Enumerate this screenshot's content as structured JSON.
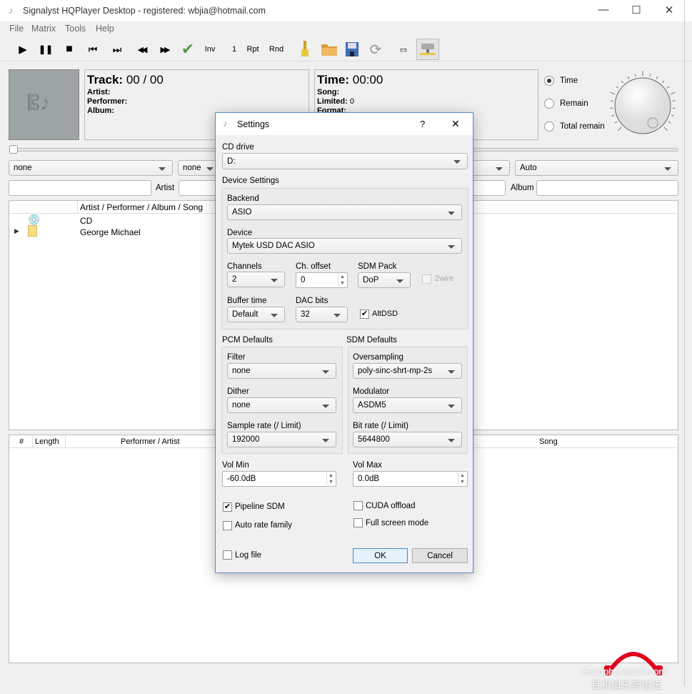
{
  "window": {
    "title": "Signalyst HQPlayer Desktop - registered: wbjia@hotmail.com",
    "minimize": "—",
    "maximize": "☐",
    "close": "✕"
  },
  "menu": [
    "File",
    "Matrix",
    "Tools",
    "Help"
  ],
  "toolbar": {
    "play": "▶",
    "pause": "❚❚",
    "stop": "■",
    "prev": "⏮",
    "next": "⏭",
    "rewind": "◀◀",
    "forward": "▶▶",
    "check": "✔",
    "inv": "Inv",
    "one": "1",
    "rpt": "Rpt",
    "rnd": "Rnd",
    "fullscreen": "▭"
  },
  "track": {
    "label": "Track:",
    "value": "00 / 00",
    "artist": "Artist:",
    "performer": "Performer:",
    "album": "Album:"
  },
  "time": {
    "label": "Time:",
    "value": "00:00",
    "song": "Song:",
    "limited": "Limited:",
    "limited_value": "0",
    "format": "Format:"
  },
  "time_mode": {
    "options": [
      "Time",
      "Remain",
      "Total remain"
    ],
    "selected": "Time"
  },
  "filters": {
    "combo1": "none",
    "combo2": "none",
    "combo3": "Auto",
    "artist_label": "Artist",
    "album_label": "Album"
  },
  "tree": {
    "header": "Artist / Performer / Album / Song",
    "items": [
      "CD",
      "George Michael"
    ]
  },
  "playlist": {
    "columns": [
      "#",
      "Length",
      "Performer / Artist",
      "Song"
    ]
  },
  "dialog": {
    "title": "Settings",
    "help": "?",
    "close": "✕",
    "cd_drive_label": "CD drive",
    "cd_drive": "D:",
    "device_settings": "Device Settings",
    "backend_label": "Backend",
    "backend": "ASIO",
    "device_label": "Device",
    "device": "Mytek USD DAC ASIO",
    "channels_label": "Channels",
    "channels": "2",
    "ch_offset_label": "Ch. offset",
    "ch_offset": "0",
    "sdm_pack_label": "SDM Pack",
    "sdm_pack": "DoP",
    "twowire": "2wire",
    "twowire_checked": false,
    "buffer_label": "Buffer time",
    "buffer": "Default",
    "dac_bits_label": "DAC bits",
    "dac_bits": "32",
    "altdsd": "AltDSD",
    "altdsd_checked": true,
    "pcm_defaults": "PCM Defaults",
    "filter_label": "Filter",
    "filter": "none",
    "dither_label": "Dither",
    "dither": "none",
    "sample_rate_label": "Sample rate (/ Limit)",
    "sample_rate": "192000",
    "sdm_defaults": "SDM Defaults",
    "oversampling_label": "Oversampling",
    "oversampling": "poly-sinc-shrt-mp-2s",
    "modulator_label": "Modulator",
    "modulator": "ASDM5",
    "bit_rate_label": "Bit rate (/ Limit)",
    "bit_rate": "5644800",
    "vol_min_label": "Vol Min",
    "vol_min": "-60.0dB",
    "vol_max_label": "Vol Max",
    "vol_max": "0.0dB",
    "pipeline_sdm": "Pipeline SDM",
    "pipeline_sdm_checked": true,
    "auto_rate": "Auto rate family",
    "cuda": "CUDA offload",
    "fullscreen": "Full screen mode",
    "log_file": "Log file",
    "ok": "OK",
    "cancel": "Cancel",
    "check_mark": "✔"
  },
  "watermark": {
    "text": "Headphoneclub.com",
    "subtext": "耳机俱乐部论坛",
    "color": "#e0001b"
  }
}
